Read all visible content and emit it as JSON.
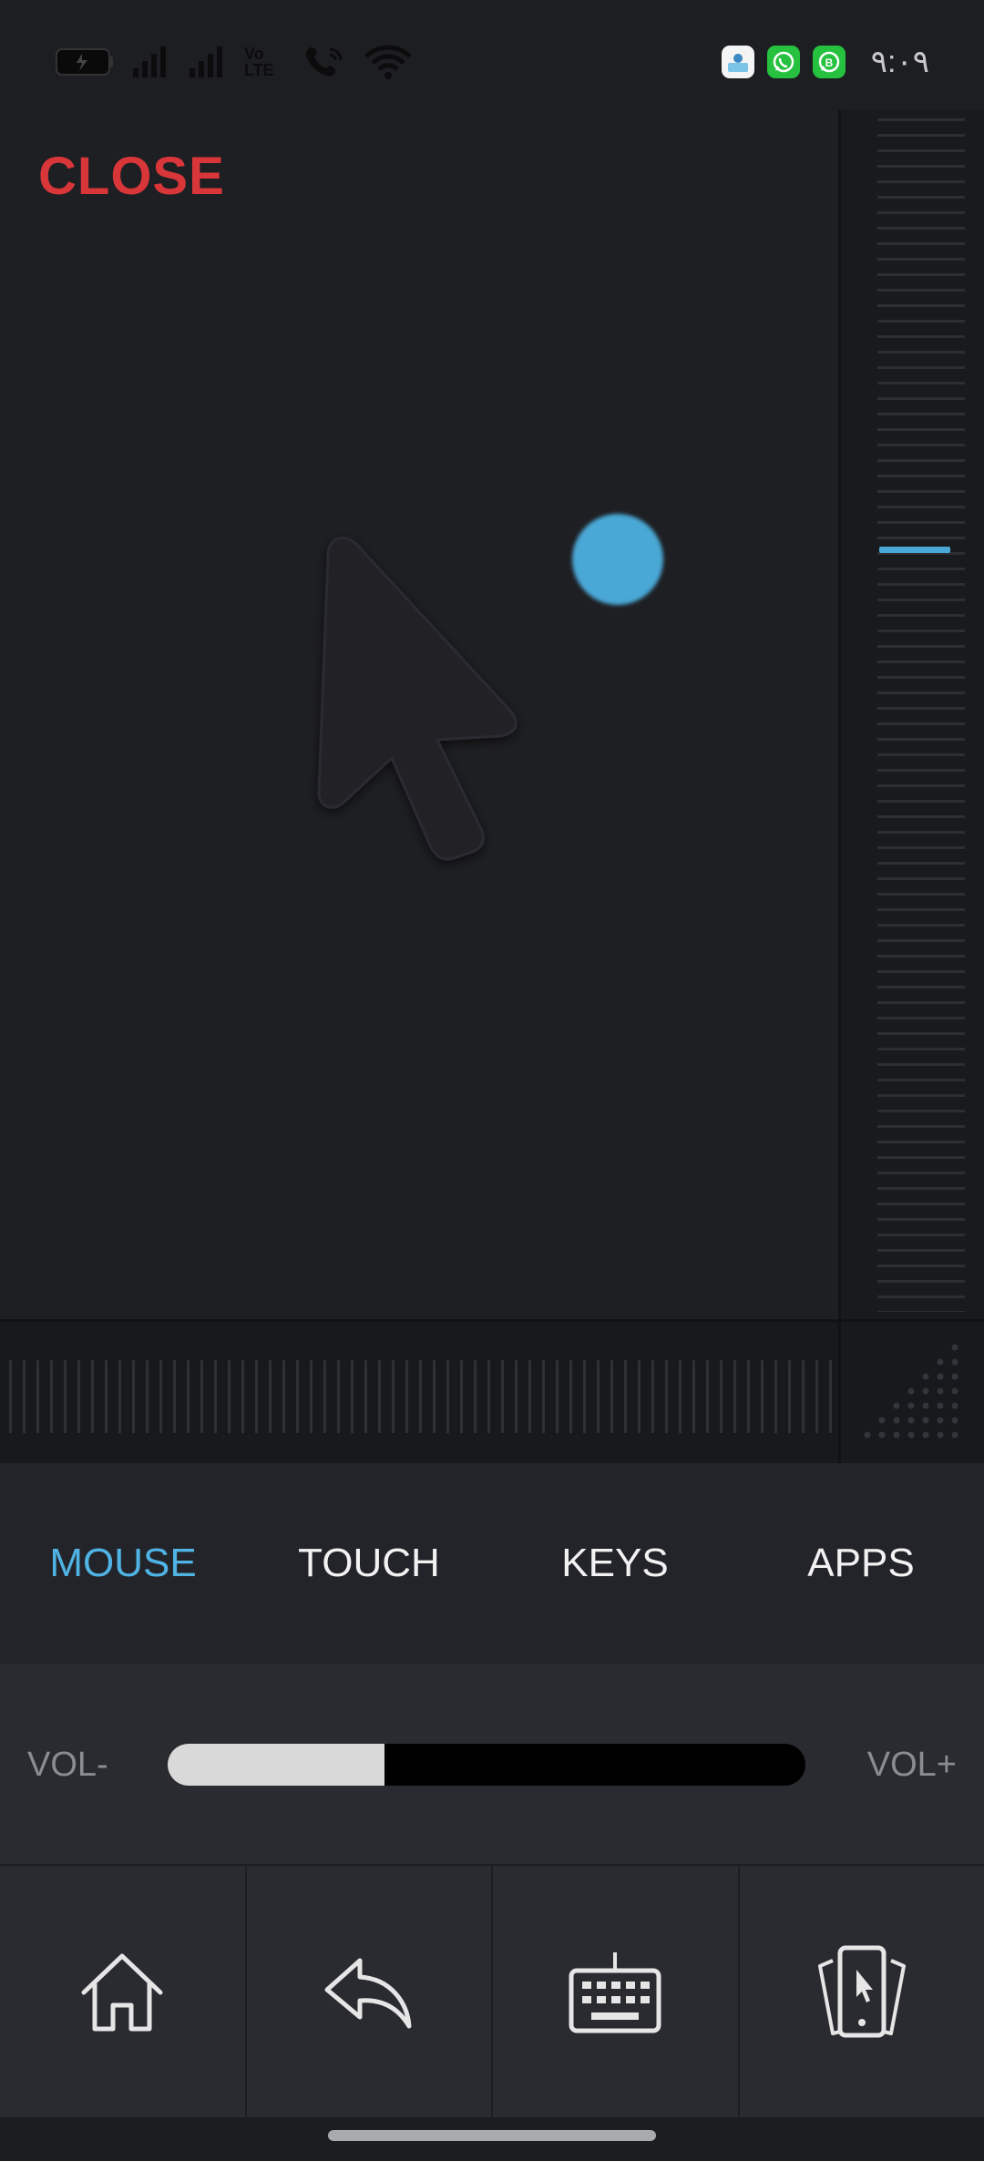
{
  "status_bar": {
    "time": "٩:٠٩",
    "signal_1_icon": "signal-bars-icon",
    "signal_2_icon": "signal-bars-icon",
    "volte_label": "Vo LTE",
    "wifi_calling_icon": "wifi-calling-icon",
    "wifi_icon": "wifi-icon",
    "notifications": [
      "app-icon",
      "whatsapp-icon",
      "whatsapp-business-icon"
    ]
  },
  "touchpad": {
    "close_label": "CLOSE",
    "cursor_icon": "mouse-pointer-icon"
  },
  "tabs": [
    {
      "label": "MOUSE",
      "active": true
    },
    {
      "label": "TOUCH",
      "active": false
    },
    {
      "label": "KEYS",
      "active": false
    },
    {
      "label": "APPS",
      "active": false
    }
  ],
  "volume": {
    "minus_label": "VOL-",
    "plus_label": "VOL+",
    "level": 0.34
  },
  "nav": {
    "home_icon": "home-icon",
    "back_icon": "back-arrow-icon",
    "keyboard_icon": "keyboard-icon",
    "apps_icon": "recent-apps-icon"
  },
  "colors": {
    "accent": "#4fb3e4",
    "close": "#d9363a",
    "background": "#1e1f23"
  }
}
